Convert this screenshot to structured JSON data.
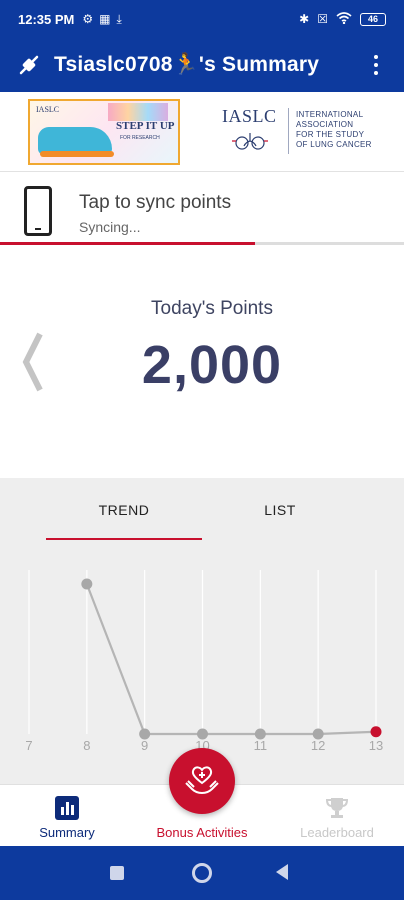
{
  "status_bar": {
    "time": "12:35 PM",
    "battery": "46",
    "icons": [
      "settings-icon",
      "qr-icon",
      "download-icon",
      "bluetooth-icon",
      "battery-saver-icon",
      "wifi-icon"
    ]
  },
  "app_bar": {
    "title": "Tsiaslc0708🏃's Summary",
    "left_icon": "sync-icon",
    "right_icon": "more-vert-icon"
  },
  "banner": {
    "left_logo_text_top": "IASLC",
    "left_logo_text": "STEP IT UP",
    "left_logo_subtext": "FOR RESEARCH",
    "right_logo_mark": "IASLC",
    "right_logo_org": [
      "INTERNATIONAL",
      "ASSOCIATION",
      "FOR THE STUDY",
      "OF LUNG CANCER"
    ]
  },
  "sync": {
    "title": "Tap to sync points",
    "status": "Syncing...",
    "progress": 0.63
  },
  "points": {
    "label": "Today's Points",
    "value": "2,000"
  },
  "tabs": {
    "trend": "TREND",
    "list": "LIST",
    "active": "trend"
  },
  "chart_data": {
    "type": "line",
    "x": [
      8,
      9,
      10,
      11,
      12,
      13
    ],
    "values": [
      2000,
      0,
      0,
      0,
      0,
      30
    ],
    "xlim": [
      7,
      13
    ],
    "tick_labels": [
      "7",
      "8",
      "9",
      "10",
      "11",
      "12",
      "13"
    ],
    "ylim": [
      0,
      2000
    ],
    "grid": true,
    "colors": {
      "line": "#b5b5b5",
      "point": "#a8a8a8",
      "highlight": "#c8102e"
    }
  },
  "bottom_nav": {
    "items": [
      {
        "label": "Summary",
        "icon": "bar-chart-icon"
      },
      {
        "label": "Bonus Activities",
        "icon": "heart-hands-icon"
      },
      {
        "label": "Leaderboard",
        "icon": "trophy-icon"
      }
    ]
  },
  "colors": {
    "primary": "#0d3a9e",
    "accent": "#c8102e",
    "nav_active": "#0d2b7a",
    "nav_disabled": "#c8c8c8"
  }
}
